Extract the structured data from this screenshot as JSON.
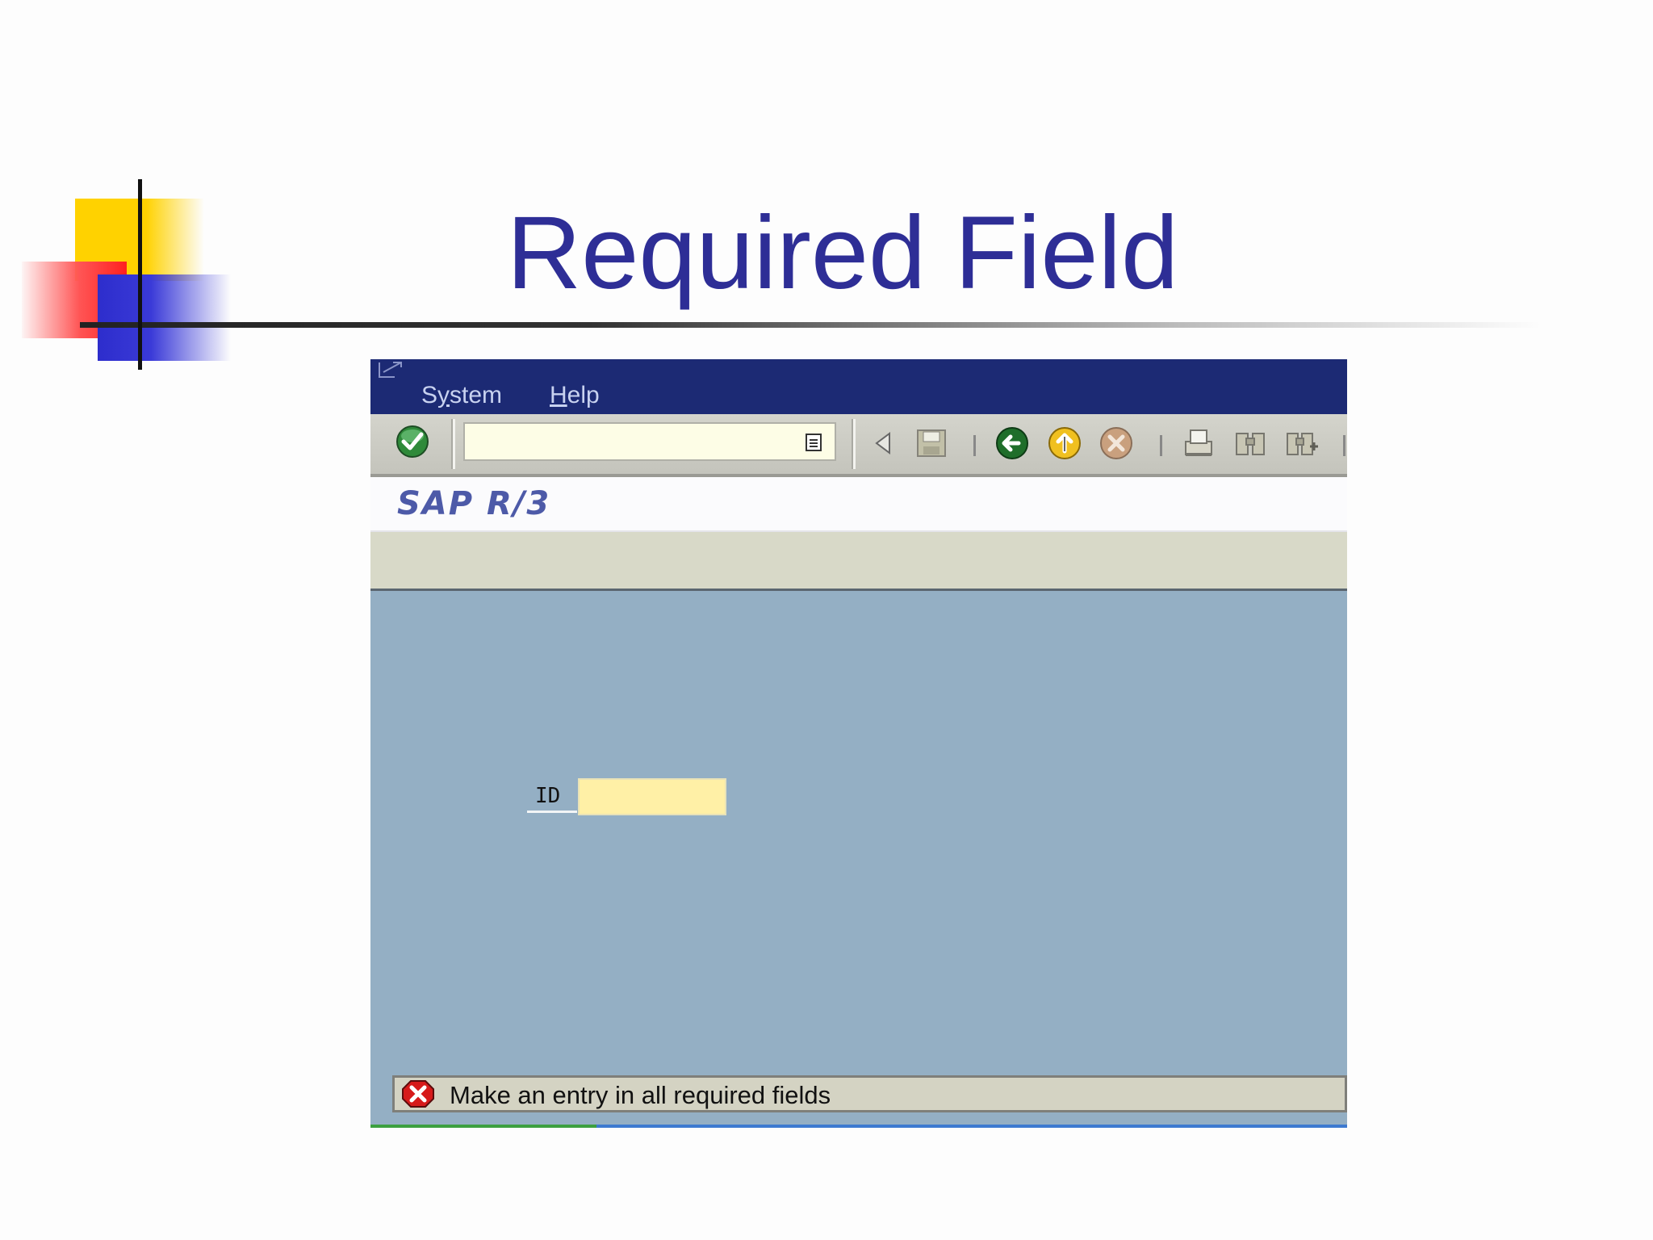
{
  "slide": {
    "title": "Required Field"
  },
  "sap": {
    "menu": {
      "system_label": "System",
      "system_underline": "y",
      "system_rest_before": "S",
      "system_rest_after": "stem",
      "help_underline": "H",
      "help_rest": "elp"
    },
    "command_field": {
      "value": ""
    },
    "toolbar_icons": [
      "enter-check-icon",
      "back-triangle-icon",
      "save-icon",
      "back-green-icon",
      "exit-yellow-icon",
      "cancel-icon",
      "print-icon",
      "find-icon",
      "find-next-icon"
    ],
    "logo": "SAP R/3",
    "form": {
      "id_label": "ID",
      "id_value": ""
    },
    "status": {
      "message": "Make an entry in all required fields",
      "type": "error"
    },
    "colors": {
      "menubar": "#1c2a74",
      "workarea": "#94afc4",
      "required_field": "#fff0a6",
      "title": "#2e2e96"
    }
  }
}
